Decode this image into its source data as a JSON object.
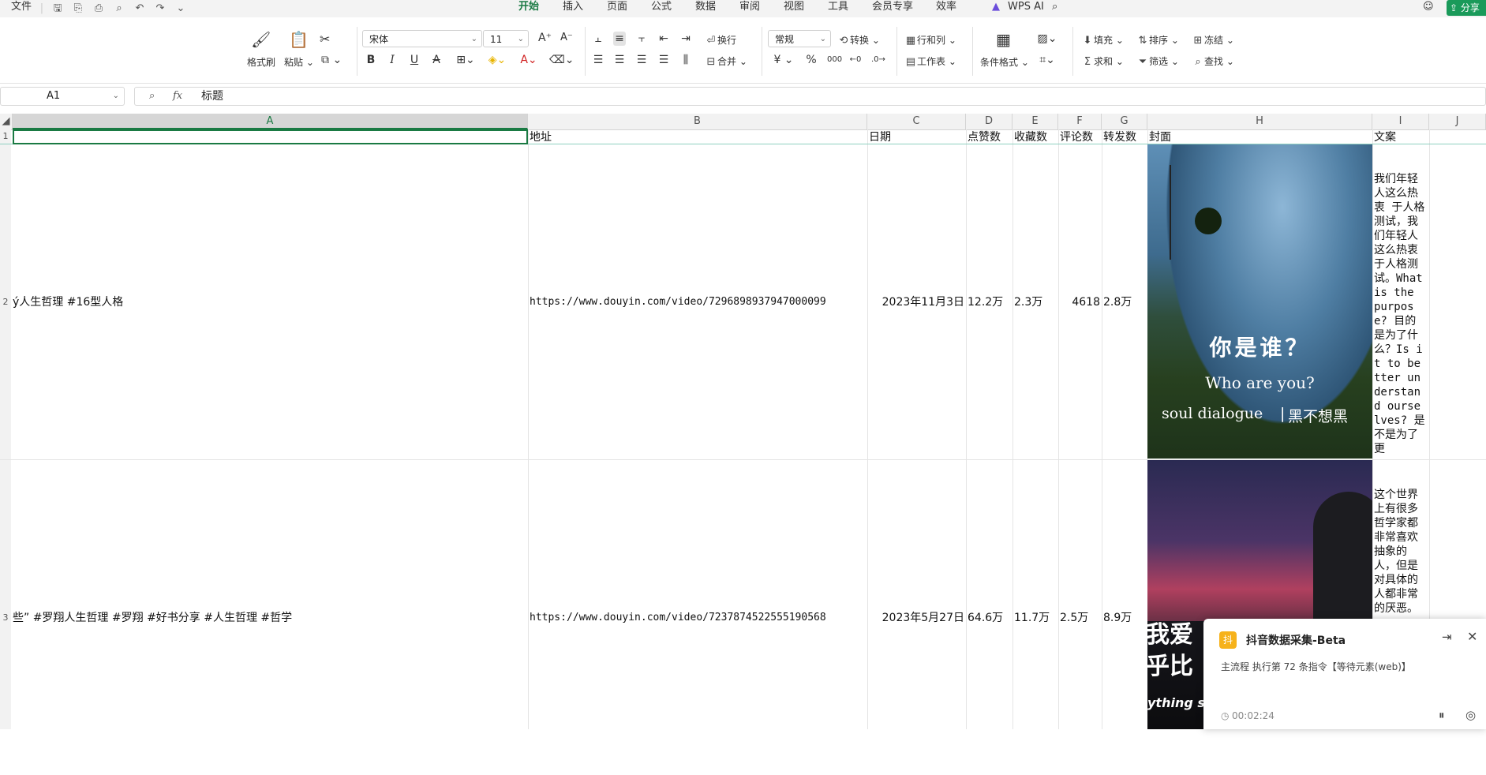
{
  "menubar": {
    "file_label": "文件",
    "tabs": [
      "开始",
      "插入",
      "页面",
      "公式",
      "数据",
      "审阅",
      "视图",
      "工具",
      "会员专享",
      "效率"
    ],
    "active_tab": "开始",
    "wps_ai_label": "WPS AI",
    "share_label": "分享"
  },
  "ribbon": {
    "format_painter": "格式刷",
    "paste": "粘贴",
    "font_name": "宋体",
    "font_size": "11",
    "wrap_text": "换行",
    "merge": "合并",
    "number_format": "常规",
    "convert": "转换",
    "rows_cols": "行和列",
    "worksheet": "工作表",
    "cond_format": "条件格式",
    "fill": "填充",
    "sort": "排序",
    "freeze": "冻结",
    "sum": "求和",
    "filter": "筛选",
    "find": "查找",
    "currency_symbol": "¥",
    "percent_symbol": "%"
  },
  "formula_bar": {
    "cell_ref": "A1",
    "fx_label": "fx",
    "content": "标题"
  },
  "columns": [
    "A",
    "B",
    "C",
    "D",
    "E",
    "F",
    "G",
    "H",
    "I",
    "J"
  ],
  "header_row": {
    "num": "1",
    "A": "",
    "B": "地址",
    "C": "日期",
    "D": "点赞数",
    "E": "收藏数",
    "F": "评论数",
    "G": "转发数",
    "H": "封面",
    "I": "文案"
  },
  "rows": [
    {
      "num": "2",
      "A": "ý人生哲理 #16型人格",
      "B": "https://www.douyin.com/video/7296898937947000099",
      "C": "2023年11月3日",
      "D": "12.2万",
      "E": "2.3万",
      "F": "4618",
      "G": "2.8万",
      "H_text": [
        "你是谁？",
        "Who are you?",
        "soul dialogue",
        "黑不想黑"
      ],
      "I": "我们年轻人这么热衷 于人格测试，我们年轻人这么热衷 于人格测试。What is the purpose? 目的是为了什么？Is it to better understand ourselves? 是不是为了更"
    },
    {
      "num": "3",
      "A": "些” #罗翔人生哲理 #罗翔 #好书分享 #人生哲理 #哲学",
      "B": "https://www.douyin.com/video/7237874522555190568",
      "C": "2023年5月27日",
      "D": "64.6万",
      "E": "11.7万",
      "F": "2.5万",
      "G": "8.9万",
      "H_text": [
        "我爱",
        "乎比",
        "ything s"
      ],
      "I": "这个世界上有很多哲学家都非常喜欢抽象的人，但是对具体的人都非常的厌恶。"
    }
  ],
  "popup": {
    "icon_char": "抖",
    "title": "抖音数据采集-Beta",
    "status": "主流程 执行第 72 条指令【等待元素(web)】",
    "timer": "00:02:24"
  }
}
